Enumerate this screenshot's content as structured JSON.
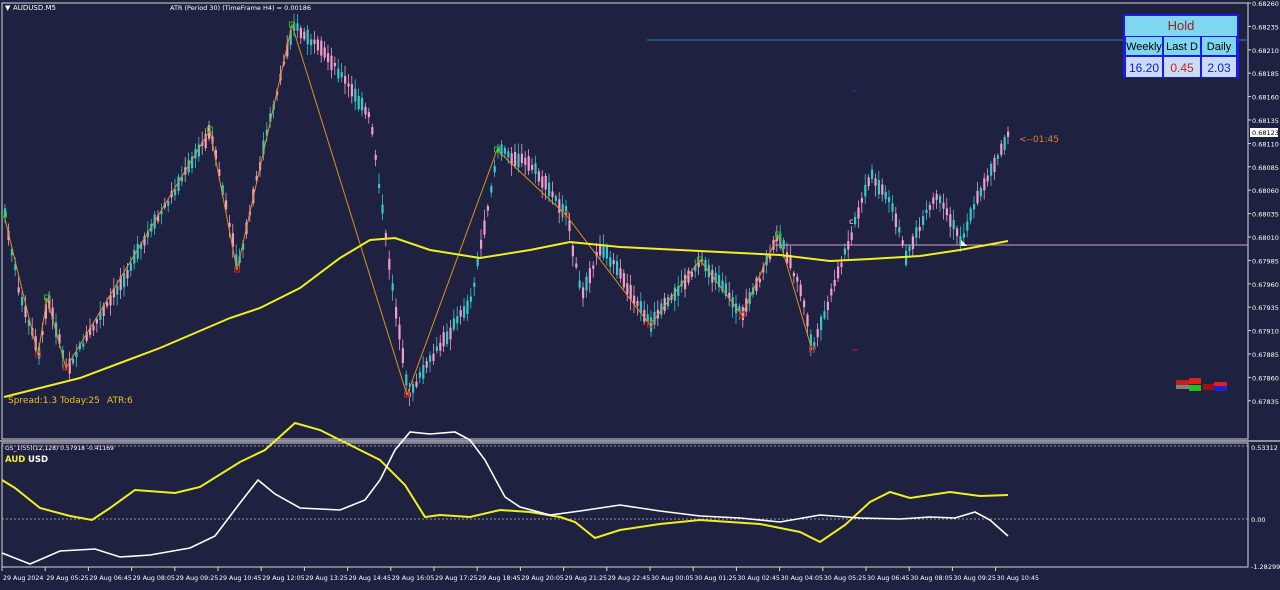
{
  "chart": {
    "symbol": "AUDUSD.M5",
    "indicator_label": "ATR (Period 30) (TimeFrame H4) = 0.00186",
    "countdown": "<--01:45",
    "current_price": "0.68123",
    "spread_text": "Spread:1.3",
    "today_text": "Today:25",
    "atr_text": "ATR:6",
    "price_ticks": [
      "0.68260",
      "0.68235",
      "0.68210",
      "0.68185",
      "0.68160",
      "0.68135",
      "0.68110",
      "0.68085",
      "0.68060",
      "0.68035",
      "0.68010",
      "0.67985",
      "0.67960",
      "0.67935",
      "0.67910",
      "0.67885",
      "0.67860",
      "0.67835"
    ],
    "time_ticks": [
      "29 Aug 2024",
      "29 Aug 05:25",
      "29 Aug 06:45",
      "29 Aug 08:05",
      "29 Aug 09:25",
      "29 Aug 10:45",
      "29 Aug 12:05",
      "29 Aug 13:25",
      "29 Aug 14:45",
      "29 Aug 16:05",
      "29 Aug 17:25",
      "29 Aug 18:45",
      "29 Aug 20:05",
      "29 Aug 21:25",
      "29 Aug 22:45",
      "30 Aug 00:05",
      "30 Aug 01:25",
      "30 Aug 02:45",
      "30 Aug 04:05",
      "30 Aug 05:25",
      "30 Aug 06:45",
      "30 Aug 08:05",
      "30 Aug 09:25",
      "30 Aug 10:45"
    ],
    "colors": {
      "background": "#1e2140",
      "bull": "#36c8c8",
      "bear": "#f09ec8",
      "ma": "#f0f020",
      "zigzag": "#e09020"
    }
  },
  "signal_panel": {
    "title": "Hold",
    "headers": [
      "Weekly",
      "Last D",
      "Daily"
    ],
    "values": [
      "16.20",
      "0.45",
      "2.03"
    ],
    "value_colors": [
      "#1a1ad0",
      "#d02020",
      "#1a1ad0"
    ]
  },
  "sub_indicator": {
    "label": "GS_1(55)(12,128) 0.57918 -0.41169",
    "aud_label": "AUD",
    "usd_label": "USD",
    "top_tick": "0.53312",
    "zero_tick": "0.00",
    "bottom_tick": "-1.28299",
    "aud_color": "#f0f020",
    "usd_color": "#ffffff"
  }
}
